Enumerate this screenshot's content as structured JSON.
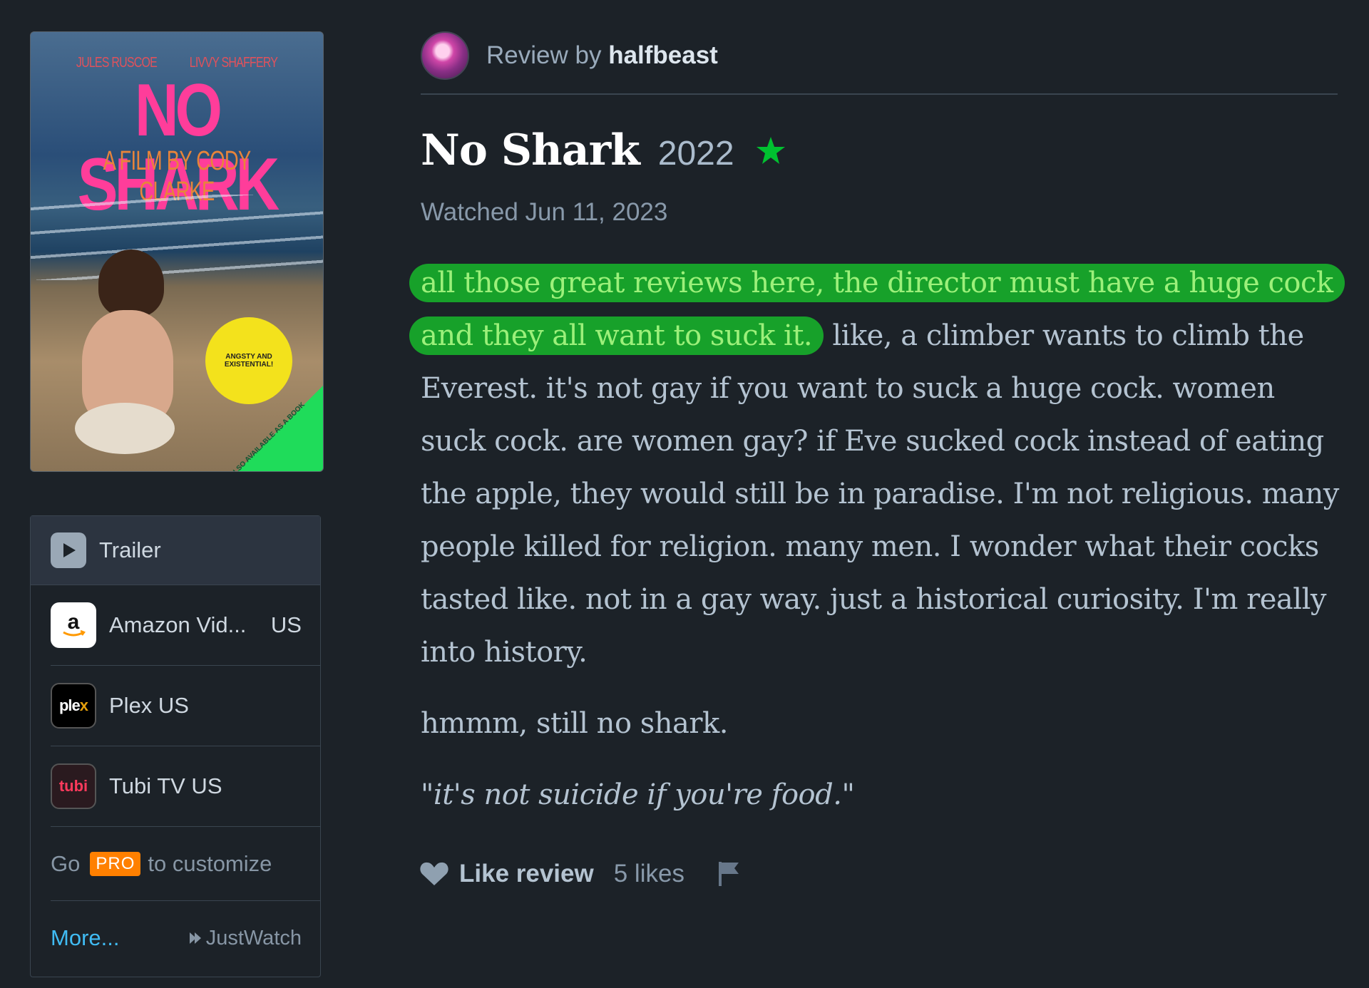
{
  "poster": {
    "credit_left": "JULES RUSCOE",
    "credit_right": "LIVVY SHAFFERY",
    "title": "NO SHARK",
    "subtitle": "A FILM BY CODY CLARKE",
    "badge": "ANGSTY AND EXISTENTIAL!",
    "corner": "ALSO AVAILABLE AS A BOOK"
  },
  "watch_panel": {
    "trailer_label": "Trailer",
    "services": [
      {
        "icon": "amazon-icon",
        "name": "Amazon Vid...",
        "region": "US"
      },
      {
        "icon": "plex-icon",
        "name": "Plex US",
        "region": ""
      },
      {
        "icon": "tubi-icon",
        "name": "Tubi TV US",
        "region": ""
      }
    ],
    "pro_prefix": "Go",
    "pro_badge": "PRO",
    "pro_suffix": "to customize",
    "more_label": "More...",
    "justwatch_label": "JustWatch"
  },
  "review": {
    "by_prefix": "Review by",
    "author": "halfbeast",
    "film_title": "No Shark",
    "year": "2022",
    "rating_stars": 1,
    "watched": "Watched Jun 11, 2023",
    "highlight": "all those great reviews here, the director must have a huge cock and they all want to suck it.",
    "text_rest": " like, a climber wants to climb the Everest. it's not gay if you want to suck a huge cock. women suck cock. are women gay? if Eve sucked cock instead of eating the apple, they would still be in paradise. I'm not religious. many people killed for religion. many men. I wonder what their cocks tasted like. not in a gay way. just a historical curiosity. I'm really into history.",
    "para2": "hmmm, still no shark.",
    "quote": "\"it's not suicide if you're food.\"",
    "like_label": "Like review",
    "likes": "5 likes"
  },
  "colors": {
    "background": "#1c2228",
    "highlight": "#17a12a",
    "star": "#00c030",
    "link": "#40bcf4",
    "pro": "#ff8000"
  }
}
